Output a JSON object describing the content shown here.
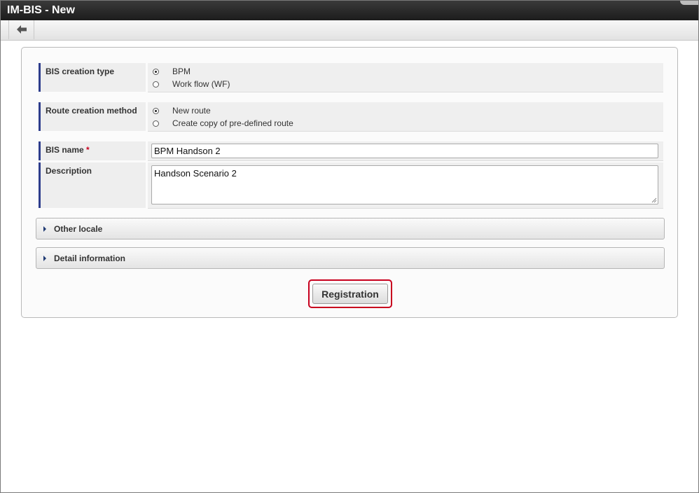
{
  "window": {
    "title": "IM-BIS - New"
  },
  "toolbar": {
    "back_icon": "arrow-left-icon"
  },
  "form": {
    "bis_creation_type": {
      "label": "BIS creation type",
      "options": [
        {
          "label": "BPM",
          "checked": true
        },
        {
          "label": "Work flow (WF)",
          "checked": false
        }
      ]
    },
    "route_creation_method": {
      "label": "Route creation method",
      "options": [
        {
          "label": "New route",
          "checked": true
        },
        {
          "label": "Create copy of pre-defined route",
          "checked": false
        }
      ]
    },
    "bis_name": {
      "label": "BIS name",
      "required_mark": "*",
      "value": "BPM Handson 2"
    },
    "description": {
      "label": "Description",
      "value": "Handson Scenario 2"
    }
  },
  "sections": [
    {
      "label": "Other locale",
      "expanded": false
    },
    {
      "label": "Detail information",
      "expanded": false
    }
  ],
  "registration_button": {
    "label": "Registration",
    "highlight_color": "#c8001e"
  }
}
